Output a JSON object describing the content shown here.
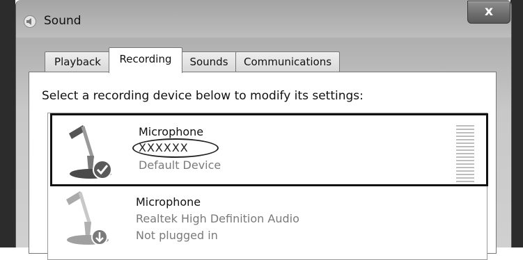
{
  "window": {
    "title": "Sound",
    "close_label": "x"
  },
  "tabs": [
    {
      "label": "Playback",
      "active": false
    },
    {
      "label": "Recording",
      "active": true
    },
    {
      "label": "Sounds",
      "active": false
    },
    {
      "label": "Communications",
      "active": false
    }
  ],
  "recording": {
    "instruction": "Select a recording device below to modify its settings:",
    "devices": [
      {
        "name": "Microphone",
        "line2": "XXXXXX",
        "line3": "Default Device",
        "selected": true,
        "icon": "microphone-icon",
        "badge": "checkmark-icon"
      },
      {
        "name": "Microphone",
        "line2": "Realtek High Definition Audio",
        "line3": "Not plugged in",
        "selected": false,
        "icon": "microphone-icon",
        "badge": "down-arrow-icon"
      }
    ]
  },
  "colors": {
    "frame": "#b8b8b8",
    "selection_border": "#111111",
    "secondary_text": "#7a7a7a"
  }
}
